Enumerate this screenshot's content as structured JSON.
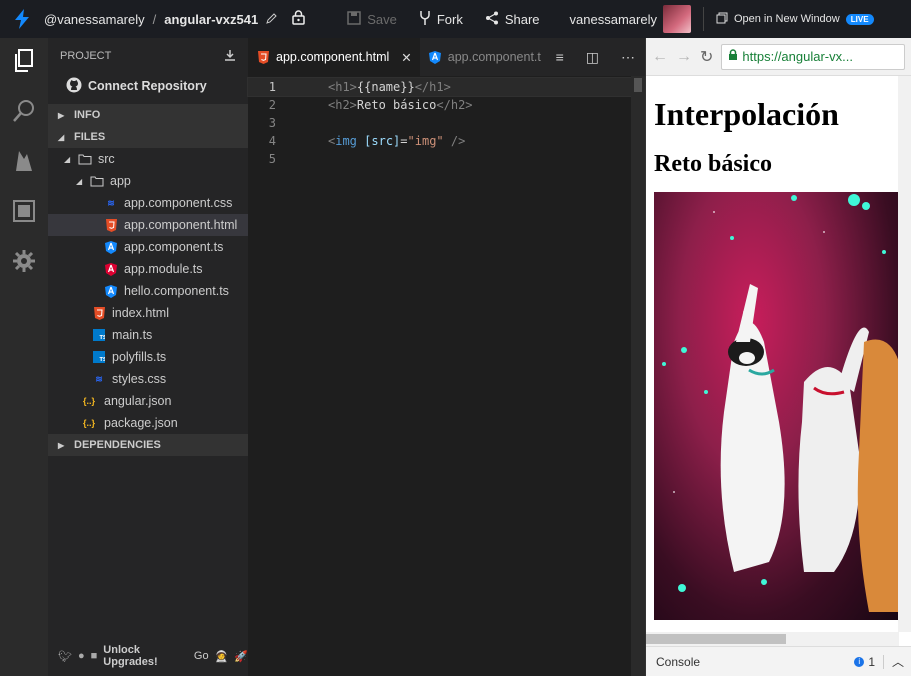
{
  "topbar": {
    "user_path": "@vanessamarely",
    "separator": "/",
    "project": "angular-vxz541",
    "save": "Save",
    "fork": "Fork",
    "share": "Share",
    "username": "vanessamarely",
    "open_new_window": "Open in New Window",
    "live": "LIVE"
  },
  "sidebar": {
    "project_label": "PROJECT",
    "connect_repo": "Connect Repository",
    "info": "INFO",
    "files": "FILES",
    "dependencies": "DEPENDENCIES",
    "tree": [
      {
        "name": "src"
      },
      {
        "name": "app"
      },
      {
        "name": "app.component.css"
      },
      {
        "name": "app.component.html"
      },
      {
        "name": "app.component.ts"
      },
      {
        "name": "app.module.ts"
      },
      {
        "name": "hello.component.ts"
      },
      {
        "name": "index.html"
      },
      {
        "name": "main.ts"
      },
      {
        "name": "polyfills.ts"
      },
      {
        "name": "styles.css"
      },
      {
        "name": "angular.json"
      },
      {
        "name": "package.json"
      }
    ],
    "footer": {
      "unlock": "Unlock Upgrades!",
      "go": "Go"
    }
  },
  "editor": {
    "tabs": [
      {
        "label": "app.component.html",
        "active": true
      },
      {
        "label": "app.component.t",
        "active": false
      }
    ],
    "line_numbers": [
      "1",
      "2",
      "3",
      "4",
      "5"
    ],
    "code": {
      "l1_open": "<h1>",
      "l1_text": "{{name}}",
      "l1_close": "</h1>",
      "l2_open": "<h2>",
      "l2_text": "Reto básico",
      "l2_close": "</h2>",
      "l4_open": "<",
      "l4_tag": "img",
      "l4_attr": " [src]",
      "l4_eq": "=",
      "l4_val": "\"img\"",
      "l4_close": " />"
    }
  },
  "preview": {
    "url": "https://angular-vx...",
    "h1": "Interpolación",
    "h2": "Reto básico",
    "console": "Console",
    "console_count": "1"
  },
  "colors": {
    "accent": "#1389fd",
    "html_icon": "#e44d26",
    "css_icon": "#2965f1",
    "angular_icon": "#dd0031",
    "json_icon": "#f5b821"
  }
}
